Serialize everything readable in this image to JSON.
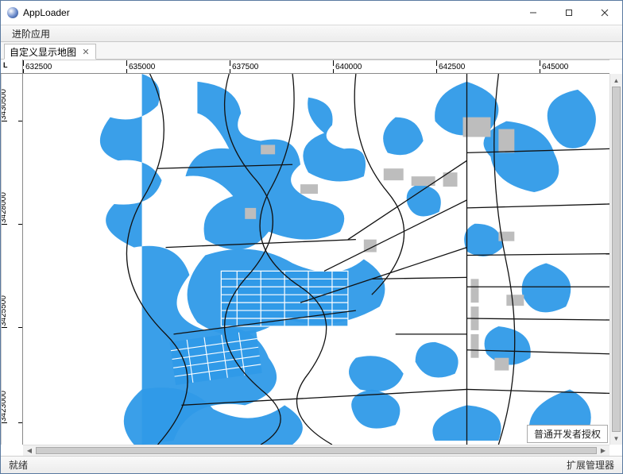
{
  "window": {
    "title": "AppLoader"
  },
  "menu": {
    "item1": "进阶应用"
  },
  "tabs": {
    "active": {
      "label": "自定义显示地图"
    }
  },
  "rulers": {
    "corner": "L",
    "x": [
      "632500",
      "635000",
      "637500",
      "640000",
      "642500",
      "645000"
    ],
    "y": [
      "3430500",
      "3428000",
      "3425500",
      "3423000"
    ]
  },
  "map": {
    "overlay_label": "普通开发者授权",
    "colors": {
      "water": "#2f9ae8",
      "road": "#111111",
      "building": "#bdbdbd",
      "bg": "#ffffff"
    }
  },
  "status": {
    "left": "就绪",
    "right": "扩展管理器"
  }
}
